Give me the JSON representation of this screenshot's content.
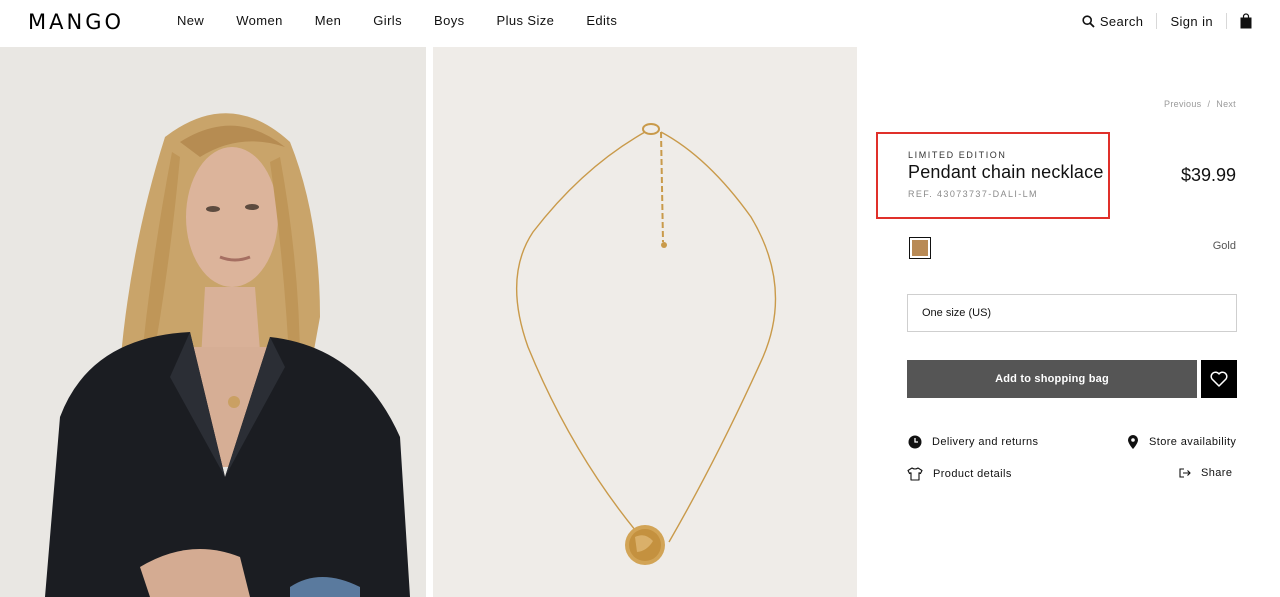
{
  "header": {
    "logo": "MANGO",
    "nav": [
      "New",
      "Women",
      "Men",
      "Girls",
      "Boys",
      "Plus Size",
      "Edits"
    ],
    "search_label": "Search",
    "signin_label": "Sign in"
  },
  "pager": {
    "previous": "Previous",
    "separator": "/",
    "next": "Next"
  },
  "product": {
    "edition": "LIMITED EDITION",
    "name": "Pendant chain necklace",
    "ref": "REF. 43073737-DALI-LM",
    "price": "$39.99",
    "color_name": "Gold",
    "size": "One size (US)",
    "add_button": "Add to shopping bag"
  },
  "links": {
    "delivery": "Delivery and returns",
    "store": "Store availability",
    "details": "Product details",
    "share": "Share"
  },
  "colors": {
    "swatch": "#b98a55",
    "add_button_bg": "#555555",
    "highlight": "#e0302a"
  }
}
